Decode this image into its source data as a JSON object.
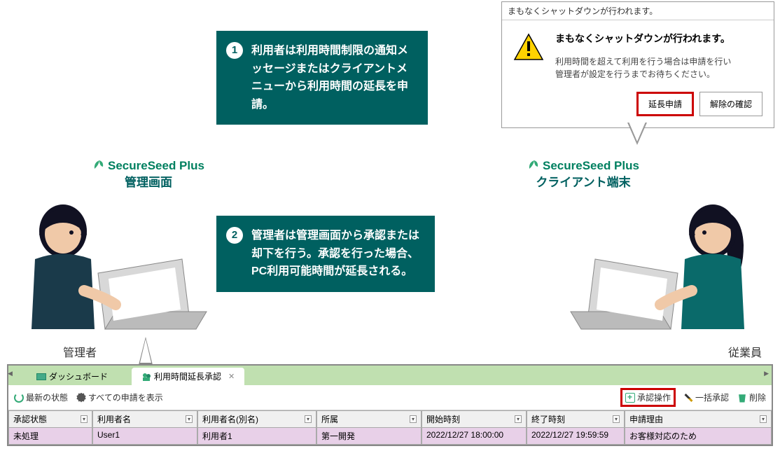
{
  "dialog": {
    "title": "まもなくシャットダウンが行われます。",
    "heading": "まもなくシャットダウンが行われます。",
    "message": "利用時間を超えて利用を行う場合は申請を行い\n管理者が設定を行うまでお待ちください。",
    "btn_extend": "延長申請",
    "btn_confirm": "解除の確認"
  },
  "callouts": {
    "c1_num": "1",
    "c1_text": "利用者は利用時間制限の通知メッセージまたはクライアントメニューから利用時間の延長を申請。",
    "c2_num": "2",
    "c2_text": "管理者は管理画面から承認または却下を行う。承認を行った場合、PC利用可能時間が延長される。"
  },
  "products": {
    "brand": "SecureSeed Plus",
    "p1_sub": "管理画面",
    "p2_sub": "クライアント端末"
  },
  "roles": {
    "admin": "管理者",
    "employee": "従業員"
  },
  "panel": {
    "tabs": {
      "dashboard": "ダッシュボード",
      "approval": "利用時間延長承認"
    },
    "toolbar": {
      "refresh": "最新の状態",
      "show_all": "すべての申請を表示",
      "approve_op": "承認操作",
      "bulk_approve": "一括承認",
      "delete": "削除"
    },
    "columns": {
      "status": "承認状態",
      "user": "利用者名",
      "user_alias": "利用者名(別名)",
      "dept": "所属",
      "start": "開始時刻",
      "end": "終了時刻",
      "reason": "申請理由"
    },
    "row": {
      "status": "未処理",
      "user": "User1",
      "user_alias": "利用者1",
      "dept": "第一開発",
      "start": "2022/12/27 18:00:00",
      "end": "2022/12/27 19:59:59",
      "reason": "お客様対応のため"
    }
  }
}
